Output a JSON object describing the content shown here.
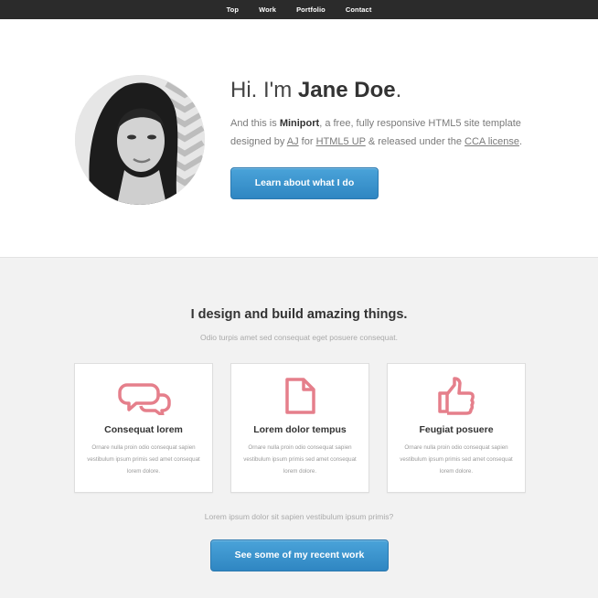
{
  "nav": {
    "items": [
      "Top",
      "Work",
      "Portfolio",
      "Contact"
    ]
  },
  "hero": {
    "greeting_prefix": "Hi. I'm ",
    "name": "Jane Doe",
    "greeting_suffix": ".",
    "intro_part1": "And this is ",
    "template_name": "Miniport",
    "intro_part2": ", a free, fully responsive HTML5 site template designed by ",
    "author_link": "AJ",
    "intro_part3": " for ",
    "site_link": "HTML5 UP",
    "intro_part4": " & released under the ",
    "license_link": "CCA license",
    "intro_part5": ".",
    "button_label": "Learn about what I do"
  },
  "work": {
    "title": "I design and build amazing things.",
    "subtitle": "Odio turpis amet sed consequat eget posuere consequat.",
    "cards": [
      {
        "icon": "comments-icon",
        "title": "Consequat lorem",
        "text": "Ornare nulla proin odio consequat sapien vestibulum ipsum primis sed amet consequat lorem dolore."
      },
      {
        "icon": "file-icon",
        "title": "Lorem dolor tempus",
        "text": "Ornare nulla proin odio consequat sapien vestibulum ipsum primis sed amet consequat lorem dolore."
      },
      {
        "icon": "thumbs-up-icon",
        "title": "Feugiat posuere",
        "text": "Ornare nulla proin odio consequat sapien vestibulum ipsum primis sed amet consequat lorem dolore."
      }
    ],
    "footer_text": "Lorem ipsum dolor sit sapien vestibulum ipsum primis?",
    "footer_button": "See some of my recent work"
  },
  "colors": {
    "accent": "#e57f8b",
    "button": "#3a93cf",
    "nav_bg": "#2b2b2b"
  }
}
